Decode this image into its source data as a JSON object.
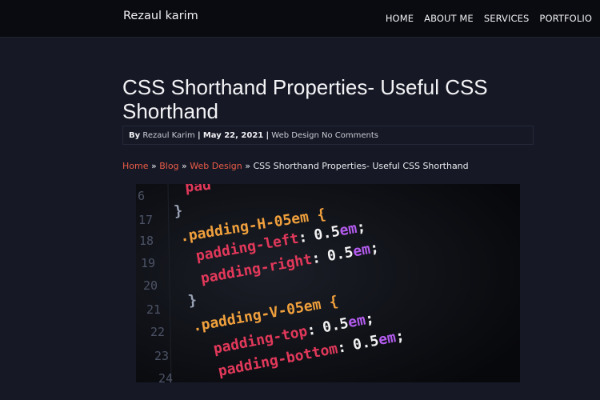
{
  "site": {
    "brand": "Rezaul karim"
  },
  "nav": {
    "items": [
      "HOME",
      "ABOUT ME",
      "SERVICES",
      "PORTFOLIO"
    ]
  },
  "post": {
    "title": "CSS Shorthand Properties- Useful CSS Shorthand",
    "meta": {
      "by_prefix": "By",
      "author": "Rezaul Karim",
      "separator": "|",
      "date": "May 22, 2021",
      "category": "Web Design",
      "comments": "No Comments"
    }
  },
  "breadcrumb": {
    "home": "Home",
    "blog": "Blog",
    "category": "Web Design",
    "current": "CSS Shorthand Properties- Useful CSS Shorthand",
    "divider": "»"
  },
  "featured_image": {
    "line_numbers": [
      "6",
      "17",
      "18",
      "19",
      "20",
      "21",
      "22",
      "23",
      "24"
    ],
    "code": {
      "partial_top": "pad",
      "close_brace": "}",
      "selector_h": ".padding-H-05em {",
      "prop_left": "padding-left",
      "prop_right": "padding-right",
      "selector_v": ".padding-V-05em {",
      "prop_top": "padding-top",
      "prop_bottom": "padding-bottom",
      "colon": ":",
      "value_num": "0.5",
      "value_unit": "em",
      "semicolon": ";"
    },
    "colors": {
      "line_number": "#4d5366",
      "selector": "#f0a03c",
      "brace": "#9aa3b5",
      "property": "#e2385a",
      "value": "#f2f2f2",
      "unit": "#b55cf0"
    }
  },
  "colors": {
    "background": "#161925",
    "topbar": "#0a0b10",
    "link_accent": "#ea5a47"
  }
}
